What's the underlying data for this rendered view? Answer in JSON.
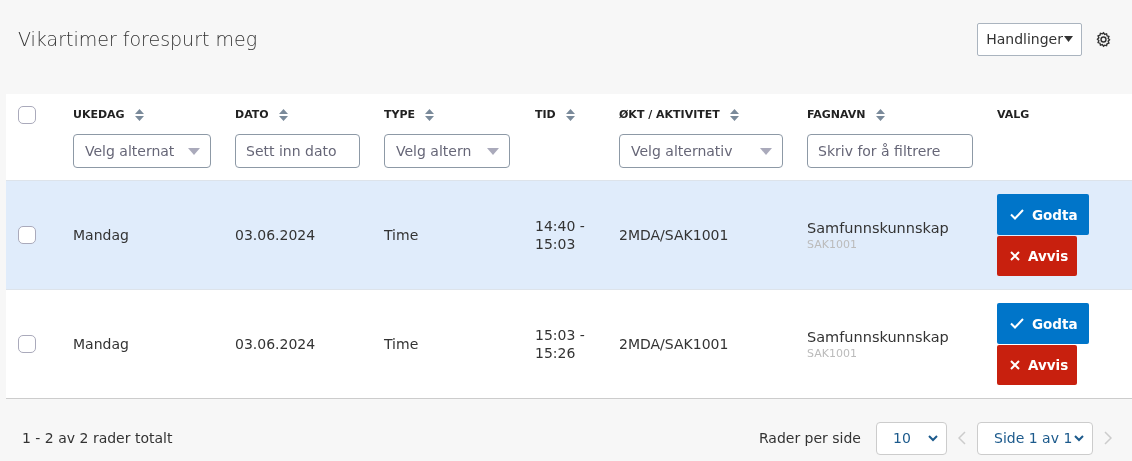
{
  "page": {
    "title": "Vikartimer forespurt meg"
  },
  "toolbar": {
    "actions_button": "Handlinger"
  },
  "table": {
    "select_all_checked": false,
    "columns": [
      {
        "label": "UKEDAG",
        "sortable": true,
        "filter": {
          "kind": "select",
          "placeholder": "Velg alternat"
        }
      },
      {
        "label": "DATO",
        "sortable": true,
        "filter": {
          "kind": "input",
          "placeholder": "Sett inn dato"
        }
      },
      {
        "label": "TYPE",
        "sortable": true,
        "filter": {
          "kind": "select",
          "placeholder": "Velg altern"
        }
      },
      {
        "label": "TID",
        "sortable": true
      },
      {
        "label": "ØKT / AKTIVITET",
        "sortable": true,
        "filter": {
          "kind": "select",
          "placeholder": "Velg alternativ"
        }
      },
      {
        "label": "FAGNAVN",
        "sortable": true,
        "filter": {
          "kind": "input",
          "placeholder": "Skriv for å filtrere"
        }
      },
      {
        "label": "VALG",
        "sortable": false
      }
    ],
    "rows": [
      {
        "checked": false,
        "highlighted": true,
        "weekday": "Mandag",
        "date": "03.06.2024",
        "type": "Time",
        "time_start": "14:40 -",
        "time_end": "15:03",
        "session": "2MDA/SAK1001",
        "subject": "Samfunnskunnskap",
        "subject_code": "SAK1001",
        "accept": "Godta",
        "reject": "Avvis"
      },
      {
        "checked": false,
        "highlighted": false,
        "weekday": "Mandag",
        "date": "03.06.2024",
        "type": "Time",
        "time_start": "15:03 -",
        "time_end": "15:26",
        "session": "2MDA/SAK1001",
        "subject": "Samfunnskunnskap",
        "subject_code": "SAK1001",
        "accept": "Godta",
        "reject": "Avvis"
      }
    ]
  },
  "footer": {
    "summary": "1 - 2 av 2 rader totalt",
    "rows_per_page_label": "Rader per side",
    "rows_per_page": "10",
    "page": "Side 1 av 1"
  }
}
